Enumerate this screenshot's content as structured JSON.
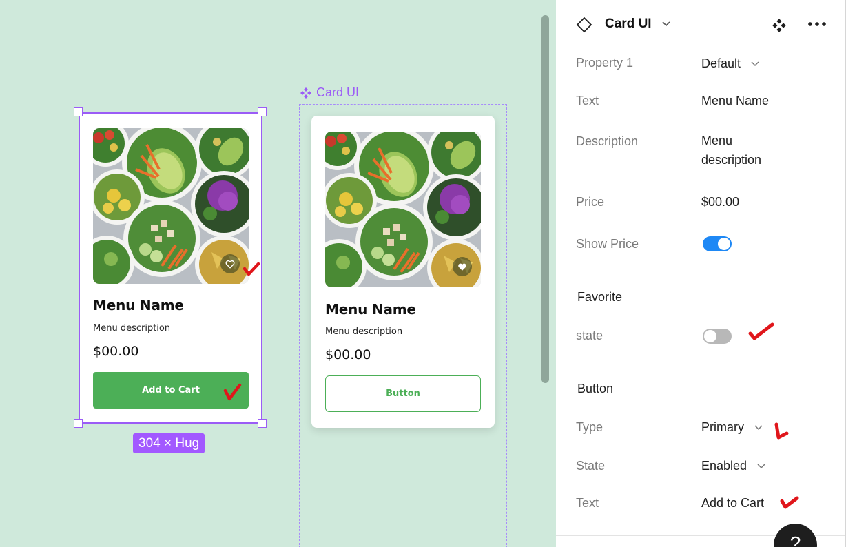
{
  "canvas": {
    "size_badge": "304 × Hug",
    "component_label": "Card UI",
    "selected_card": {
      "menu_name": "Menu Name",
      "menu_description": "Menu description",
      "price": "$00.00",
      "button_label": "Add to Cart"
    },
    "component_card": {
      "menu_name": "Menu Name",
      "menu_description": "Menu description",
      "price": "$00.00",
      "button_label": "Button"
    },
    "colors": {
      "canvas_bg": "#cfe9db",
      "selection": "#9b5cf6",
      "primary_green": "#4caf57"
    }
  },
  "panel": {
    "title": "Card UI",
    "properties": [
      {
        "label": "Property 1",
        "value": "Default",
        "control": "dropdown"
      },
      {
        "label": "Text",
        "value": "Menu Name",
        "control": "text"
      },
      {
        "label": "Description",
        "value": "Menu description",
        "control": "text"
      },
      {
        "label": "Price",
        "value": "$00.00",
        "control": "text"
      },
      {
        "label": "Show Price",
        "value": true,
        "control": "toggle"
      }
    ],
    "favorite": {
      "title": "Favorite",
      "state_label": "state",
      "state_value": false
    },
    "button": {
      "title": "Button",
      "type_label": "Type",
      "type_value": "Primary",
      "state_label": "State",
      "state_value": "Enabled",
      "text_label": "Text",
      "text_value": "Add to Cart"
    },
    "help_label": "?",
    "colors": {
      "toggle_on": "#1e88f5",
      "toggle_off": "#b8b8b8"
    }
  }
}
